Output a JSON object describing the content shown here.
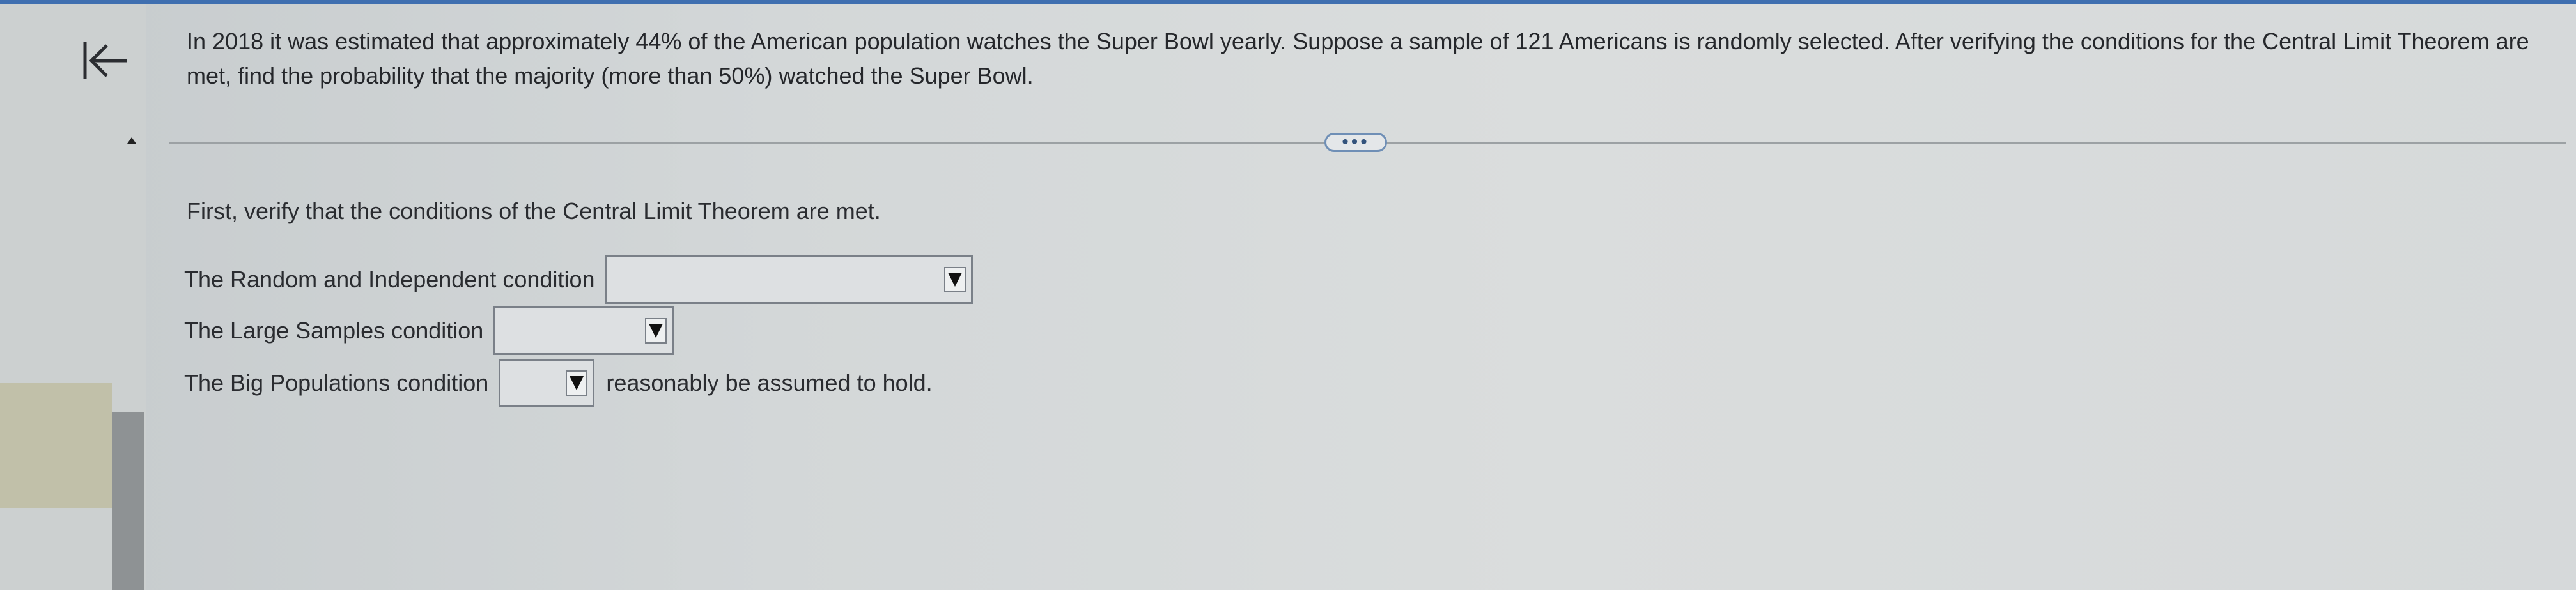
{
  "question": {
    "text": "In 2018 it was estimated that approximately 44% of the American population watches the Super Bowl yearly. Suppose a sample of 121 Americans is randomly selected. After verifying the conditions for the Central Limit Theorem are met, find the probability that the majority (more than 50%) watched the Super Bowl."
  },
  "more_button": {
    "label": "•••"
  },
  "instructions": "First, verify that the conditions of the Central Limit Theorem are met.",
  "conditions": [
    {
      "label": "The Random and Independent condition",
      "selected": "",
      "suffix": ""
    },
    {
      "label": "The Large Samples condition",
      "selected": "",
      "suffix": ""
    },
    {
      "label": "The Big Populations condition",
      "selected": "",
      "suffix": "reasonably be assumed to hold."
    }
  ],
  "icons": {
    "back": "arrow-left-to-bar-icon",
    "collapse": "triangle-up-icon",
    "dropdown": "triangle-down-icon"
  },
  "colors": {
    "top_bar": "#3f6fb0",
    "more_button_border": "#6f8fb6"
  }
}
